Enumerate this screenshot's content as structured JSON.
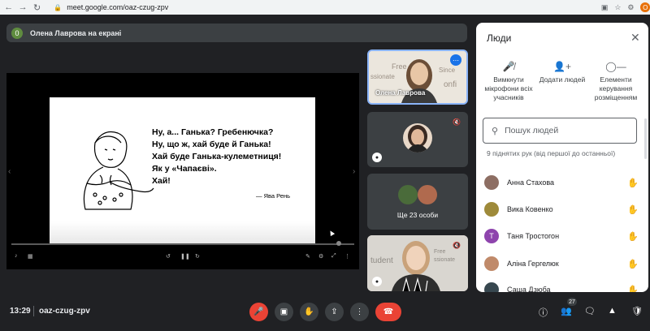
{
  "browser": {
    "url": "meet.google.com/oaz-czug-zpv",
    "profile_initial": "O"
  },
  "presenter": {
    "badge": "0",
    "text": "Олена Лаврова на екрані"
  },
  "slide": {
    "lines": [
      "Ну, а... Ганька? Гребенючка?",
      "Ну, що ж, хай буде й Ганька!",
      "Хай буде Ганька-кулеметниця!",
      "Як у «Чапаєві».",
      "Хай!"
    ],
    "author": "— Ява Рень"
  },
  "tiles": {
    "main_speaker": "Олена Лаврова",
    "others_label": "Ще 23 особи"
  },
  "people_panel": {
    "title": "Люди",
    "actions": [
      {
        "icon": "mic-off-icon",
        "label": "Вимкнути мікрофони всіх учасників"
      },
      {
        "icon": "add-person-icon",
        "label": "Додати людей"
      },
      {
        "icon": "toggle-icon",
        "label": "Елементи керування розміщенням"
      }
    ],
    "search_placeholder": "Пошук людей",
    "hands_heading": "9 піднятих рук (від першої до останньої)",
    "participants": [
      {
        "name": "Анна Стахова",
        "avatar_color": "#8d6e63",
        "initial": ""
      },
      {
        "name": "Вика Ковенко",
        "avatar_color": "#9e8a3a",
        "initial": ""
      },
      {
        "name": "Таня Тростогон",
        "avatar_color": "#8e44ad",
        "initial": "T"
      },
      {
        "name": "Аліна Гергелюк",
        "avatar_color": "#c08a6a",
        "initial": ""
      },
      {
        "name": "Саша Дзюба",
        "avatar_color": "#37474f",
        "initial": ""
      }
    ]
  },
  "bottom_bar": {
    "time": "13:29",
    "meeting_code": "oaz-czug-zpv",
    "people_count": "27"
  },
  "colors": {
    "accent": "#1a73e8",
    "danger": "#ea4335",
    "background": "#202124"
  }
}
